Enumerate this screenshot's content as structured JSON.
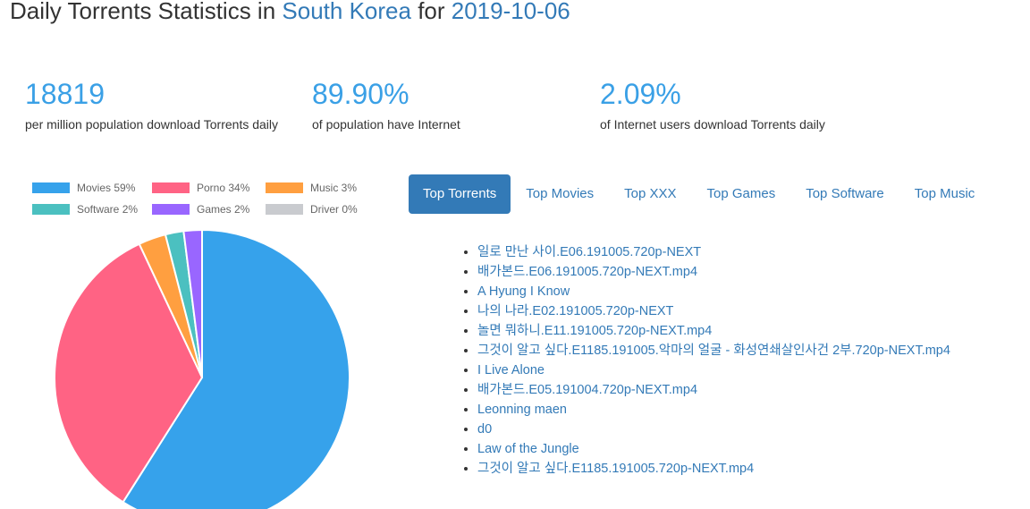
{
  "header": {
    "title_prefix": "Daily Torrents Statistics in ",
    "country": "South Korea",
    "title_mid": " for ",
    "date": "2019-10-06"
  },
  "stats": [
    {
      "value": "18819",
      "label": "per million population download Torrents daily"
    },
    {
      "value": "89.90%",
      "label": "of population have Internet"
    },
    {
      "value": "2.09%",
      "label": "of Internet users download Torrents daily"
    }
  ],
  "legend": [
    {
      "label": "Movies 59%",
      "color": "#36a2eb"
    },
    {
      "label": "Porno 34%",
      "color": "#ff6384"
    },
    {
      "label": "Music 3%",
      "color": "#ff9f40"
    },
    {
      "label": "Software 2%",
      "color": "#4bc0c0"
    },
    {
      "label": "Games 2%",
      "color": "#9966ff"
    },
    {
      "label": "Driver 0%",
      "color": "#c9cbcf"
    }
  ],
  "chart_data": {
    "type": "pie",
    "categories": [
      "Movies",
      "Porno",
      "Music",
      "Software",
      "Games",
      "Driver"
    ],
    "values": [
      59,
      34,
      3,
      2,
      2,
      0
    ],
    "colors": [
      "#36a2eb",
      "#ff6384",
      "#ff9f40",
      "#4bc0c0",
      "#9966ff",
      "#c9cbcf"
    ],
    "legend_position": "top"
  },
  "tabs": [
    {
      "label": "Top Torrents",
      "active": true
    },
    {
      "label": "Top Movies",
      "active": false
    },
    {
      "label": "Top XXX",
      "active": false
    },
    {
      "label": "Top Games",
      "active": false
    },
    {
      "label": "Top Software",
      "active": false
    },
    {
      "label": "Top Music",
      "active": false
    }
  ],
  "torrents": [
    "일로 만난 사이.E06.191005.720p-NEXT",
    "배가본드.E06.191005.720p-NEXT.mp4",
    "A Hyung I Know",
    "나의 나라.E02.191005.720p-NEXT",
    "놀면 뭐하니.E11.191005.720p-NEXT.mp4",
    "그것이 알고 싶다.E1185.191005.악마의 얼굴 - 화성연쇄살인사건 2부.720p-NEXT.mp4",
    "I Live Alone",
    "배가본드.E05.191004.720p-NEXT.mp4",
    "Leonning maen",
    "d0",
    "Law of the Jungle",
    "그것이 알고 싶다.E1185.191005.720p-NEXT.mp4"
  ]
}
